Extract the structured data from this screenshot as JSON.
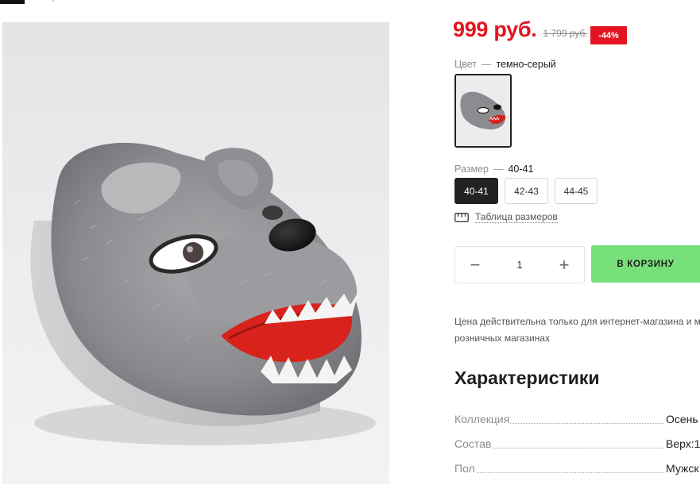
{
  "header": {
    "breadcrumb_dots": "· /"
  },
  "product": {
    "price": "999 руб.",
    "old_price": "1 799 руб.",
    "discount": "-44%",
    "color": {
      "label": "Цвет",
      "separator": "—",
      "value": "темно-серый"
    },
    "size": {
      "label": "Размер",
      "separator": "—",
      "value": "40-41",
      "options": [
        {
          "label": "40-41",
          "selected": true
        },
        {
          "label": "42-43",
          "selected": false
        },
        {
          "label": "44-45",
          "selected": false
        }
      ]
    },
    "size_table_label": "Таблица размеров",
    "quantity": {
      "minus": "−",
      "value": "1",
      "plus": "+"
    },
    "cart_button": "В КОРЗИНУ",
    "note": {
      "line1": "Цена действительна только для интернет-магазина и м",
      "line2": "розничных магазинах"
    }
  },
  "specs": {
    "title": "Характеристики",
    "rows": [
      {
        "key": "Коллекция",
        "value": "Осень"
      },
      {
        "key": "Состав",
        "value": "Верх:1"
      },
      {
        "key": "Пол",
        "value": "Мужск"
      }
    ]
  },
  "icons": {
    "ruler": "ruler-icon"
  },
  "colors": {
    "price_red": "#e3141f",
    "cart_green": "#78e07a",
    "selected_dark": "#222222"
  }
}
